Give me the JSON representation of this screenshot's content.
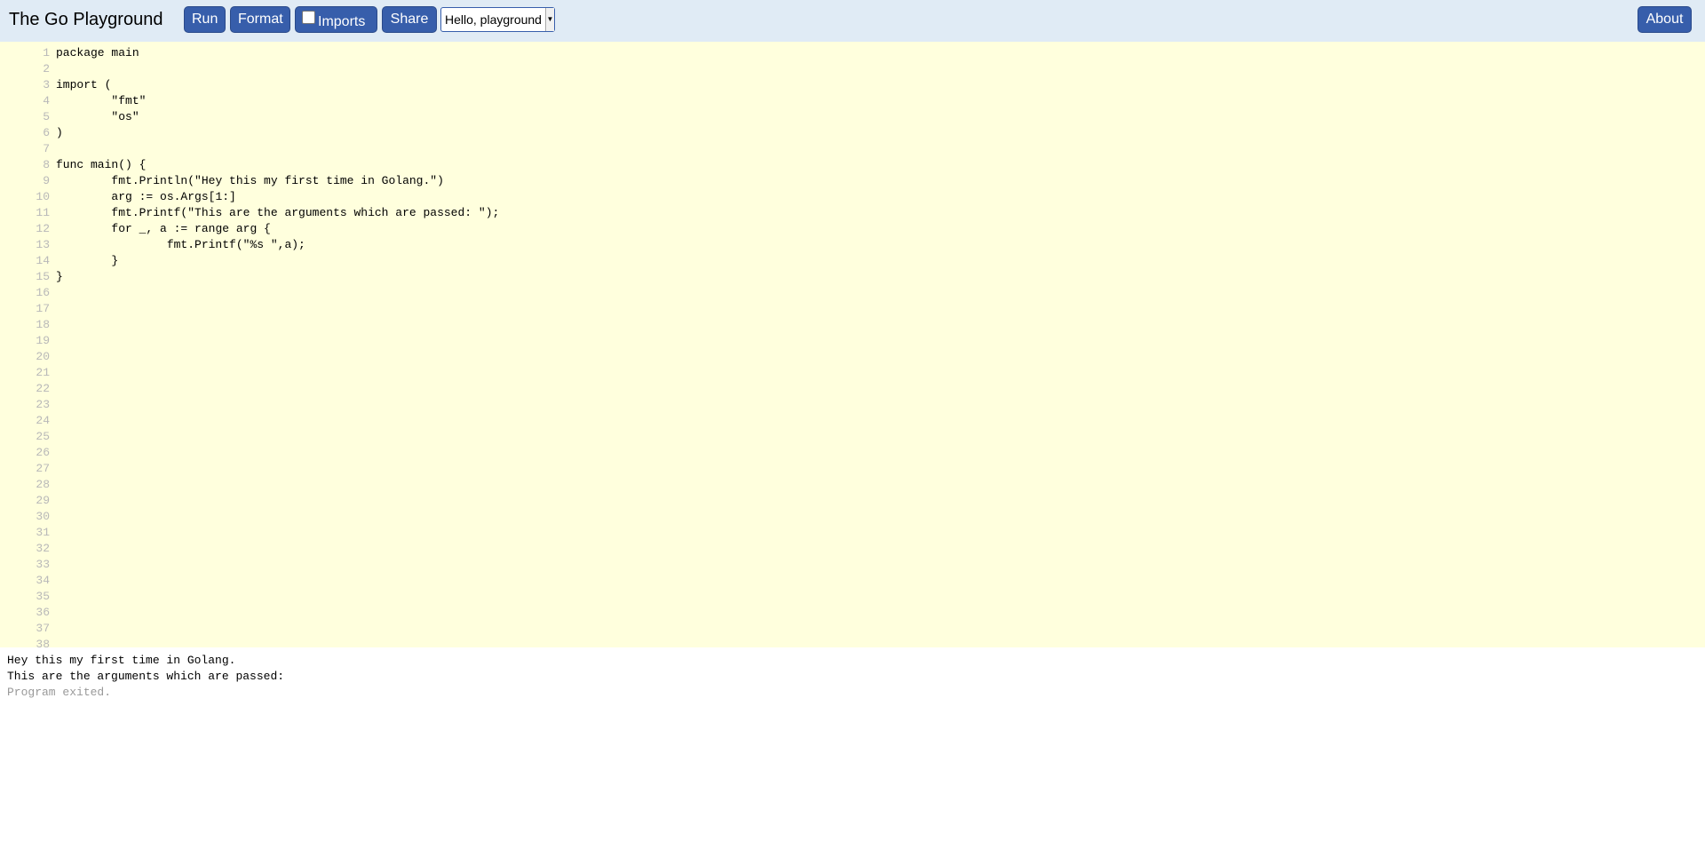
{
  "header": {
    "title": "The Go Playground",
    "run_label": "Run",
    "format_label": "Format",
    "imports_label": "Imports",
    "imports_checked": false,
    "share_label": "Share",
    "example_selected": "Hello, playground",
    "about_label": "About"
  },
  "editor": {
    "line_numbers": [
      "1",
      "2",
      "3",
      "4",
      "5",
      "6",
      "7",
      "8",
      "9",
      "10",
      "11",
      "12",
      "13",
      "14",
      "15",
      "16",
      "17",
      "18",
      "19",
      "20",
      "21",
      "22",
      "23",
      "24",
      "25",
      "26",
      "27",
      "28",
      "29",
      "30",
      "31",
      "32",
      "33",
      "34",
      "35",
      "36",
      "37",
      "38"
    ],
    "code": "package main\n\nimport (\n\t\"fmt\"\n\t\"os\"\n)\n\nfunc main() {\n\tfmt.Println(\"Hey this my first time in Golang.\")\n\targ := os.Args[1:]\n\tfmt.Printf(\"This are the arguments which are passed: \");\n\tfor _, a := range arg {\n\t\tfmt.Printf(\"%s \",a);\n\t}\n}"
  },
  "output": {
    "lines": [
      "Hey this my first time in Golang.",
      "This are the arguments which are passed: "
    ],
    "status": "Program exited."
  },
  "colors": {
    "banner_bg": "#e0ebf5",
    "button_bg": "#375eab",
    "editor_bg": "#ffffdd",
    "line_number_color": "#b8b8b8",
    "system_text_color": "#999999"
  }
}
